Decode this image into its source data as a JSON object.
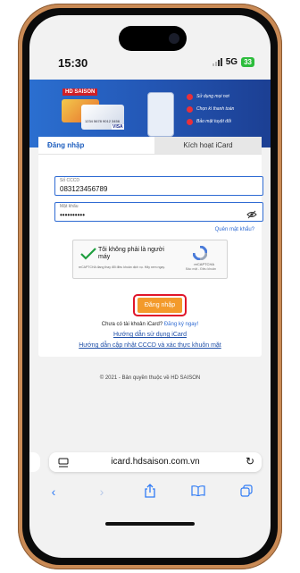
{
  "status": {
    "time": "15:30",
    "network": "5G",
    "battery": "33"
  },
  "banner": {
    "logo_text": "HD SAISON",
    "card_number": "1234 5678 9012 3456",
    "card_brand": "VISA",
    "items": [
      "Sử dụng mọi nơi",
      "Chọn kì thanh toán",
      "Bảo mật tuyệt đối"
    ]
  },
  "login": {
    "tab_login": "Đăng nhập",
    "tab_activate": "Kích hoạt iCard",
    "id_label": "Số CCCD",
    "id_value": "083123456789",
    "password_label": "Mật khẩu",
    "password_value": "••••••••••",
    "forgot": "Quên mật khẩu?",
    "captcha_label": "Tôi không phải là người máy",
    "captcha_small": "reCAPTCHA đang thay đổi điều khoản dịch vụ. Hãy xem ngay.",
    "captcha_brand": "reCAPTCHA",
    "captcha_sub": "Bảo mật - Điều khoản",
    "login_button": "Đăng nhập",
    "no_account": "Chưa có tài khoản iCard?",
    "signup_link": "Đăng ký ngay!",
    "guide_icard": "Hướng dẫn sử dụng iCard",
    "guide_update": "Hướng dẫn cập nhật CCCD và xác thực khuôn mặt"
  },
  "footer": {
    "copyright": "© 2021 - Bản quyền thuộc về HD SAISON"
  },
  "browser": {
    "url": "icard.hdsaison.com.vn",
    "icons": [
      "back-icon",
      "forward-icon",
      "share-icon",
      "bookmarks-icon",
      "tabs-icon"
    ]
  },
  "colors": {
    "accent": "#2f6bd3",
    "button": "#f39a2b",
    "highlight": "#e0152a",
    "frame": "#c98a55"
  }
}
